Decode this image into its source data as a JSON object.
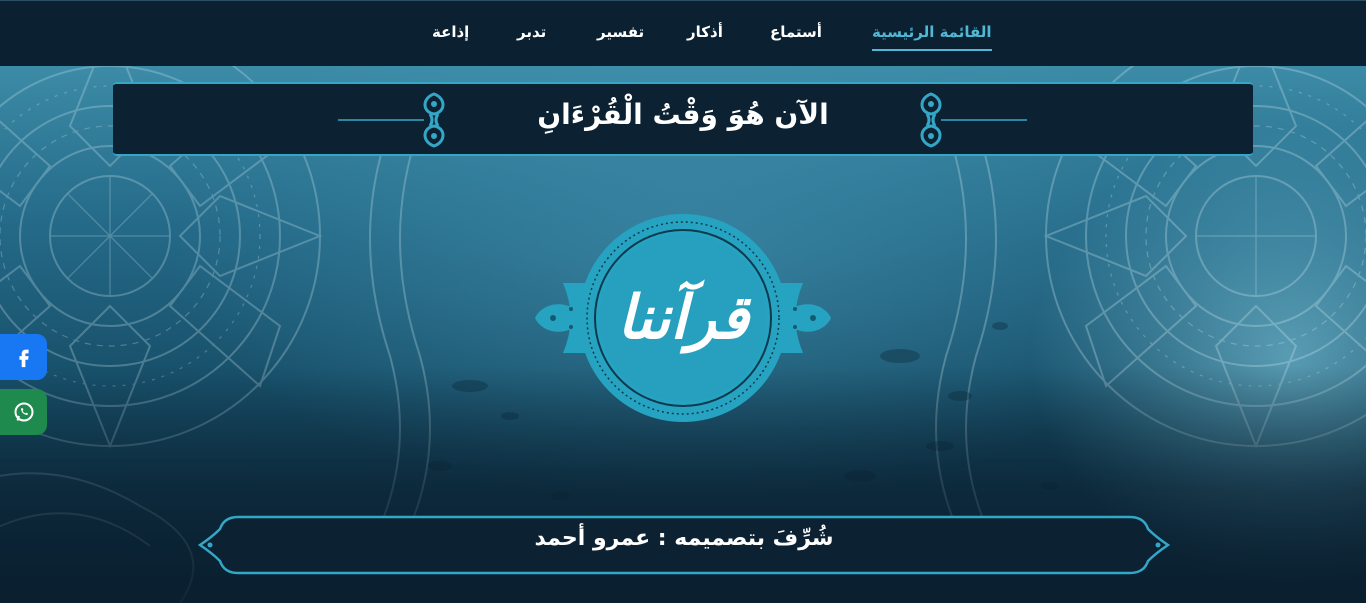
{
  "nav": {
    "items": [
      {
        "label": "القائمة الرئيسية",
        "active": true
      },
      {
        "label": "أستماع",
        "active": false
      },
      {
        "label": "أذكار",
        "active": false
      },
      {
        "label": "تفسير",
        "active": false
      },
      {
        "label": "تدبر",
        "active": false
      },
      {
        "label": "إذاعة",
        "active": false
      }
    ]
  },
  "hero": {
    "title": "الآن هُوَ وَقْتُ الْقُرْءَانِ",
    "logo_text": "قرآننا",
    "credit": "شُرِّفَ بتصميمه : عمرو أحمد"
  },
  "social": {
    "facebook_icon": "facebook-icon",
    "whatsapp_icon": "whatsapp-icon"
  },
  "colors": {
    "accent": "#4fb8d6",
    "nav_bg": "#0b2131",
    "panel_bg": "#0c2233",
    "logo_teal": "#27a3c2",
    "facebook": "#1877f2",
    "whatsapp": "#1e8a4e"
  }
}
